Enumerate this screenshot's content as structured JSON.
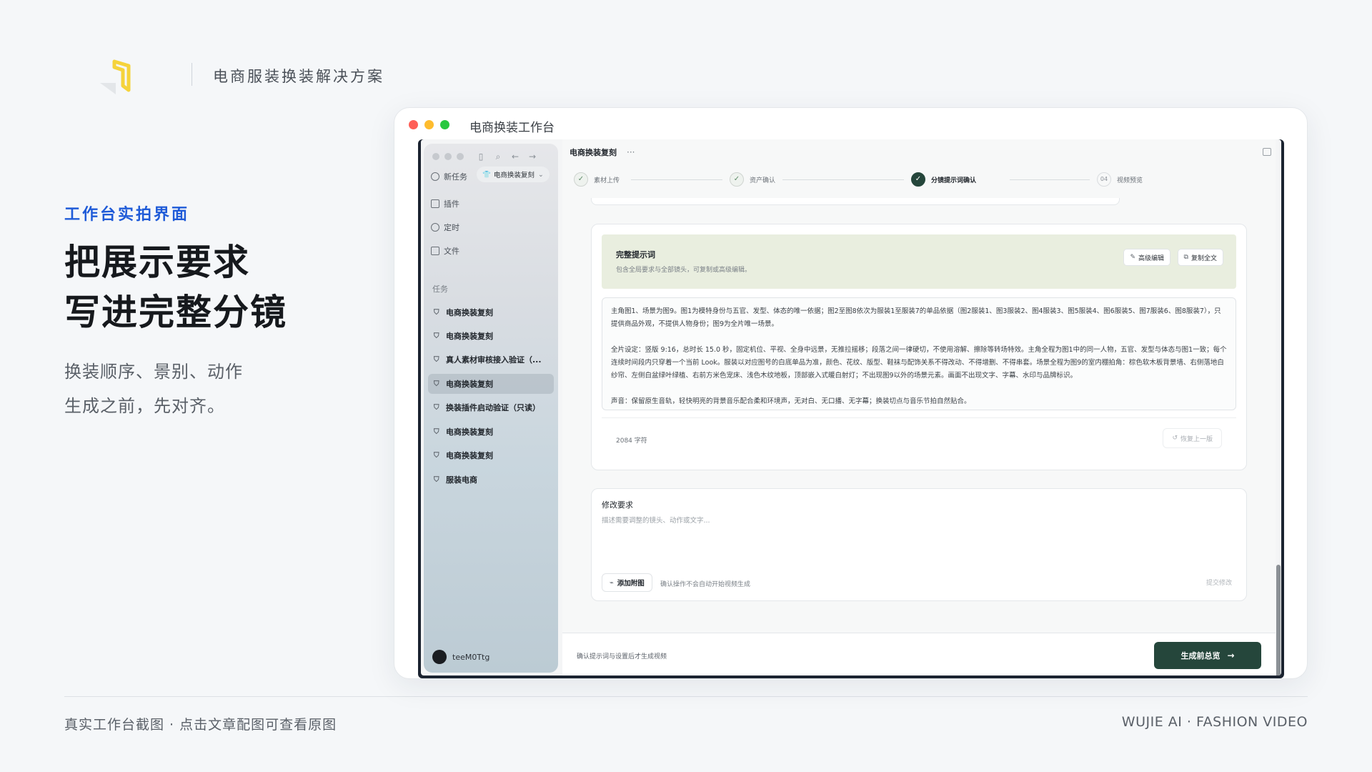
{
  "brand": {
    "tagline": "电商服装换装解决方案",
    "logo_color": "#f5d33b"
  },
  "copy": {
    "eyebrow": "工作台实拍界面",
    "headline": [
      "把展示要求",
      "写进完整分镜"
    ],
    "sub": [
      "换装顺序、景别、动作",
      "生成之前，先对齐。"
    ],
    "accent_color": "#1f5bd8"
  },
  "footer": {
    "left": "真实工作台截图 · 点击文章配图可查看原图",
    "right": "WUJIE AI · FASHION VIDEO"
  },
  "window": {
    "title": "电商换装工作台"
  },
  "sidebar": {
    "new_task": "新任务",
    "current_pill": "电商换装复刻",
    "menu": [
      "插件",
      "定时",
      "文件"
    ],
    "section_label": "任务",
    "tasks": [
      {
        "label": "电商换装复刻"
      },
      {
        "label": "电商换装复刻"
      },
      {
        "label": "真人素材审核接入验证（..."
      },
      {
        "label": "电商换装复刻",
        "active": true
      },
      {
        "label": "换装插件启动验证（只读）"
      },
      {
        "label": "电商换装复刻"
      },
      {
        "label": "电商换装复刻"
      },
      {
        "label": "服装电商"
      }
    ],
    "user": "teeM0Ttg"
  },
  "main": {
    "title": "电商换装复刻",
    "more": "···",
    "steps": [
      {
        "label": "素材上传",
        "state": "done"
      },
      {
        "label": "资产确认",
        "state": "done"
      },
      {
        "label": "分镜提示词确认",
        "state": "current"
      },
      {
        "number": "04",
        "label": "视频预览",
        "state": "pending"
      }
    ],
    "prompt_card": {
      "title": "完整提示词",
      "subtitle": "包含全局要求与全部镜头，可复制或高级编辑。",
      "advanced_edit": "高级编辑",
      "copy_all": "复制全文",
      "paragraphs": [
        "主角图1、场景为图9。图1为模特身份与五官、发型、体态的唯一依据；图2至图8依次为服装1至服装7的单品依据（图2服装1、图3服装2、图4服装3、图5服装4、图6服装5、图7服装6、图8服装7），只提供商品外观，不提供人物身份；图9为全片唯一场景。",
        "全片设定：竖版 9:16，总时长 15.0 秒，固定机位、平视、全身中远景，无推拉摇移；段落之间一律硬切，不使用溶解、擦除等转场特效。主角全程为图1中的同一人物，五官、发型与体态与图1一致；每个连续时间段内只穿着一个当前 Look。服装以对应图号的白底单品为准，颜色、花纹、版型、鞋袜与配饰关系不得改动、不得增删、不得串套。场景全程为图9的室内棚拍角：棕色软木板背景墙、右侧落地白纱帘、左侧白盆绿叶绿植、右前方米色宠床、浅色木纹地板，顶部嵌入式暖白射灯；不出现图9以外的场景元素。画面不出现文字、字幕、水印与品牌标识。",
        "声音：保留原生音轨，轻快明亮的背景音乐配合柔和环境声，无对白、无口播、无字幕；换装切点与音乐节拍自然贴合。"
      ],
      "char_count": "2084 字符",
      "restore": "恢复上一版"
    },
    "edit_card": {
      "label": "修改要求",
      "placeholder": "描述需要调整的镜头、动作或文字...",
      "attach": "添加附图",
      "attach_hint": "确认操作不会自动开始视频生成",
      "submit": "提交修改"
    },
    "bottom": {
      "hint": "确认提示词与设置后才生成视频",
      "generate": "生成前总览",
      "primary_color": "#25463b"
    }
  }
}
